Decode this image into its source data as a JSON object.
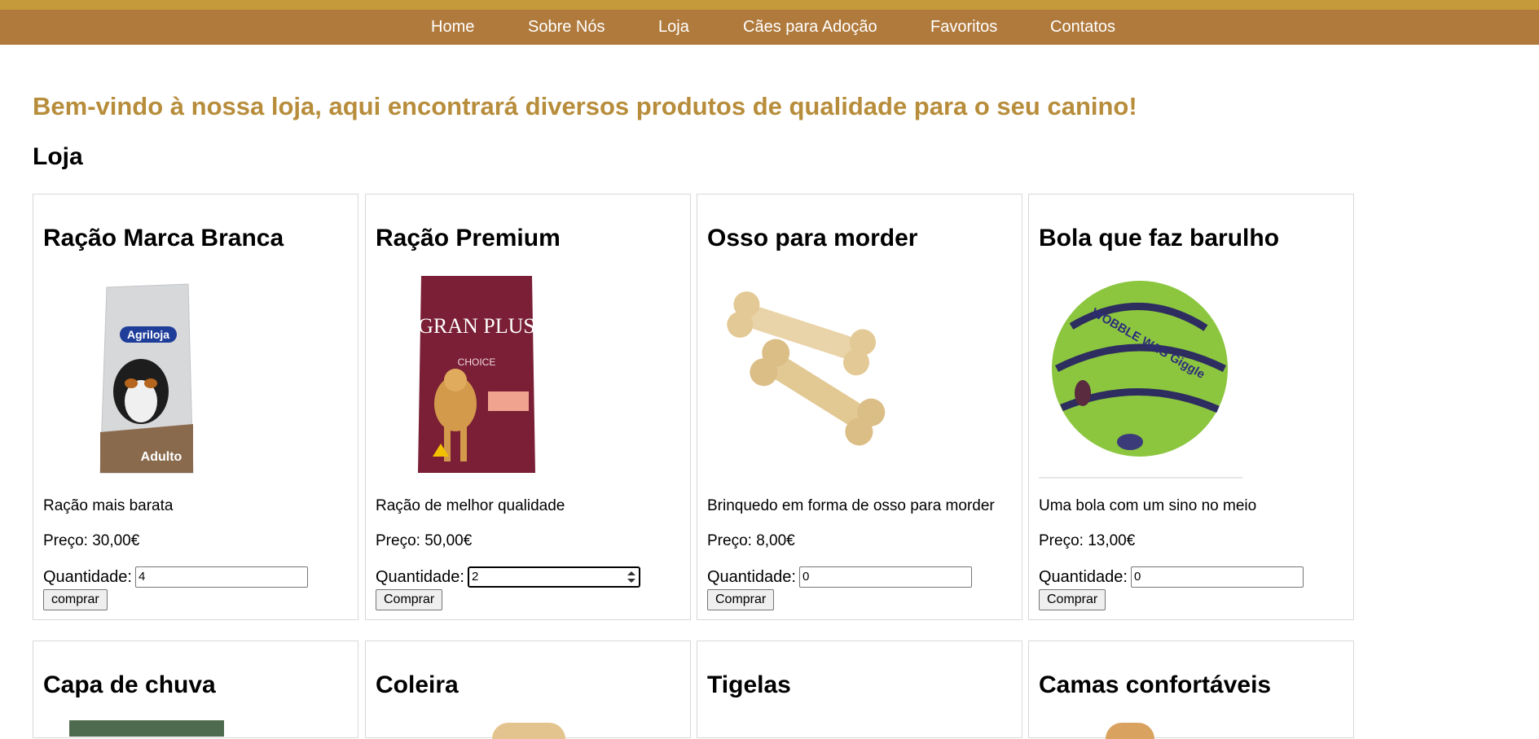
{
  "nav": {
    "items": [
      "Home",
      "Sobre Nós",
      "Loja",
      "Cães para Adoção",
      "Favoritos",
      "Contatos"
    ]
  },
  "page": {
    "welcome": "Bem-vindo à nossa loja, aqui encontrará diversos produtos de qualidade para o seu canino!",
    "title": "Loja"
  },
  "products": [
    {
      "name": "Ração Marca Branca",
      "description": "Ração mais barata",
      "price": "Preço: 30,00€",
      "quantity_label": "Quantidade:",
      "quantity": "4",
      "button": "comprar",
      "image": "dog-food-bag-white",
      "image_label": "Agriloja",
      "image_sublabel": "Adulto"
    },
    {
      "name": "Ração Premium",
      "description": "Ração de melhor qualidade",
      "price": "Preço: 50,00€",
      "quantity_label": "Quantidade:",
      "quantity": "2",
      "button": "Comprar",
      "image": "dog-food-bag-premium",
      "image_label": "GRAN PLUS",
      "image_sublabel": "CHOICE"
    },
    {
      "name": "Osso para morder",
      "description": "Brinquedo em forma de osso para morder",
      "price": "Preço: 8,00€",
      "quantity_label": "Quantidade:",
      "quantity": "0",
      "button": "Comprar",
      "image": "chew-bones"
    },
    {
      "name": "Bola que faz barulho",
      "description": "Uma bola com um sino no meio",
      "price": "Preço: 13,00€",
      "quantity_label": "Quantidade:",
      "quantity": "0",
      "button": "Comprar",
      "image": "wobble-ball",
      "image_label": "WOBBLE WAG Giggle"
    },
    {
      "name": "Capa de chuva"
    },
    {
      "name": "Coleira"
    },
    {
      "name": "Tigelas"
    },
    {
      "name": "Camas confortáveis"
    }
  ],
  "colors": {
    "top_strip": "#c49a3a",
    "navbar": "#b07a3d",
    "welcome_text": "#b78d3b"
  }
}
